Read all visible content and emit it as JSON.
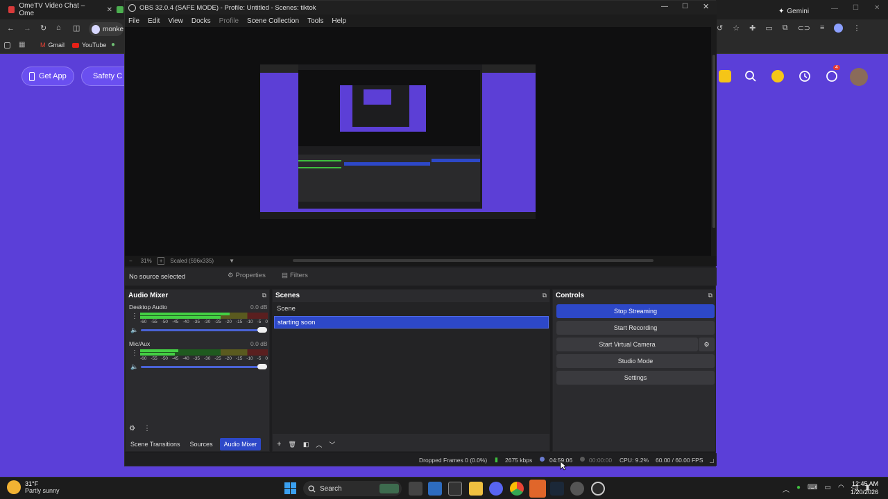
{
  "browser": {
    "tabs": [
      {
        "label": "OmeTV Video Chat – Ome"
      },
      {
        "label": "monke"
      }
    ],
    "gemini_label": "Gemini",
    "bookmarks": [
      {
        "label": "Gmail"
      },
      {
        "label": "YouTube"
      }
    ],
    "page_buttons": [
      {
        "label": "Get App"
      },
      {
        "label": "Safety C"
      }
    ],
    "notification_count": "4",
    "colors": {
      "page_bg": "#5b3fd8",
      "accent": "#6a4ff0"
    }
  },
  "obs": {
    "title": "OBS 32.0.4 (SAFE MODE) - Profile: Untitled - Scenes: tiktok",
    "menu": [
      {
        "label": "File",
        "disabled": false
      },
      {
        "label": "Edit",
        "disabled": false
      },
      {
        "label": "View",
        "disabled": false
      },
      {
        "label": "Docks",
        "disabled": false
      },
      {
        "label": "Profile",
        "disabled": true
      },
      {
        "label": "Scene Collection",
        "disabled": false
      },
      {
        "label": "Tools",
        "disabled": false
      },
      {
        "label": "Help",
        "disabled": false
      }
    ],
    "zoom": {
      "percent": "31%",
      "scaled": "Scaled (596x335)"
    },
    "source_bar": {
      "no_source": "No source selected",
      "properties": "Properties",
      "filters": "Filters"
    },
    "audio_mixer": {
      "title": "Audio Mixer",
      "ticks": [
        "-60",
        "-55",
        "-50",
        "-45",
        "-40",
        "-35",
        "-30",
        "-25",
        "-20",
        "-15",
        "-10",
        "-5",
        "0"
      ],
      "channels": [
        {
          "name": "Desktop Audio",
          "db": "0.0 dB",
          "level": 0.7
        },
        {
          "name": "Mic/Aux",
          "db": "0.0 dB",
          "level": 0.3
        }
      ]
    },
    "scenes": {
      "title": "Scenes",
      "items": [
        {
          "label": "Scene",
          "selected": false
        },
        {
          "label": "starting soon",
          "selected": true
        }
      ]
    },
    "controls": {
      "title": "Controls",
      "stop_streaming": "Stop Streaming",
      "start_recording": "Start Recording",
      "start_virtual_camera": "Start Virtual Camera",
      "studio_mode": "Studio Mode",
      "settings": "Settings"
    },
    "bottom_tabs": [
      {
        "label": "Scene Transitions",
        "active": false
      },
      {
        "label": "Sources",
        "active": false
      },
      {
        "label": "Audio Mixer",
        "active": true
      }
    ],
    "status": {
      "dropped_frames": "Dropped Frames 0 (0.0%)",
      "bitrate": "2675 kbps",
      "stream_time": "04:59:06",
      "record_time": "00:00:00",
      "cpu": "CPU: 9.2%",
      "fps": "60.00 / 60.00 FPS"
    },
    "colors": {
      "selected": "#2d48c8",
      "stream_btn": "#2d48c8"
    }
  },
  "taskbar": {
    "weather_temp": "31°F",
    "weather_desc": "Partly sunny",
    "search_label": "Search",
    "time": "12:45 AM",
    "date": "1/20/2026"
  }
}
